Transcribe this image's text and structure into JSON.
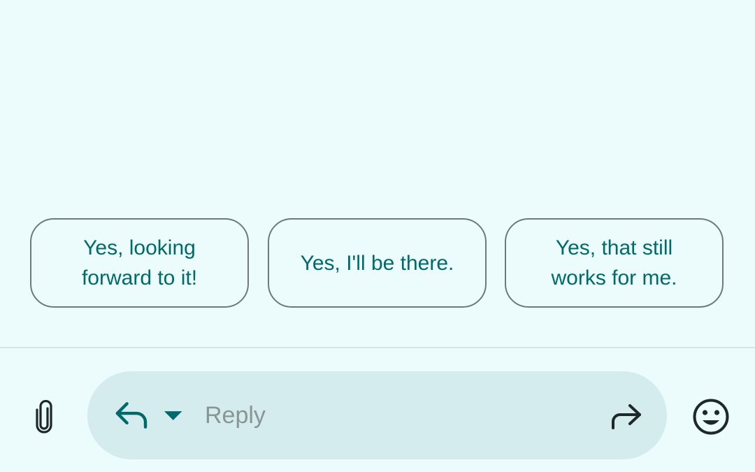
{
  "smart_replies": [
    {
      "label": "Yes, looking\nforward to it!"
    },
    {
      "label": "Yes, I'll be there."
    },
    {
      "label": "Yes, that still\nworks for me."
    }
  ],
  "compose": {
    "placeholder": "Reply",
    "value": ""
  },
  "icons": {
    "attach": "paperclip-icon",
    "reply_mode": "reply-arrow-icon",
    "reply_mode_menu": "dropdown-triangle-icon",
    "forward": "forward-arrow-icon",
    "emoji": "smiley-face-icon"
  },
  "colors": {
    "background": "#ecfbfc",
    "chip_text": "#006a6a",
    "chip_border": "#6f7979",
    "compose_background": "#d4eced",
    "accent": "#00696b"
  }
}
